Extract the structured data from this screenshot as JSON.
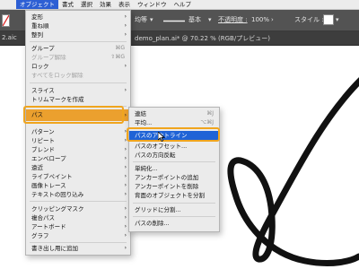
{
  "menubar": {
    "items": [
      "",
      "オブジェクト",
      "書式",
      "選択",
      "効果",
      "表示",
      "ウィンドウ",
      "ヘルプ"
    ]
  },
  "controlbar": {
    "uniform_label": "均等",
    "stroke_profile_label": "基本",
    "opacity_label": "不透明度 :",
    "opacity_value": "100%",
    "style_label": "スタイル :"
  },
  "tab": {
    "left_fragment": "2.aic",
    "document_title": "demo_plan.ai* @ 70.22 % (RGB/プレビュー)"
  },
  "object_menu": {
    "items": [
      {
        "label": "変形",
        "arrow": "›"
      },
      {
        "label": "重ね順",
        "arrow": "›"
      },
      {
        "label": "整列",
        "arrow": "›"
      },
      {
        "label": "グループ",
        "shortcut": "⌘G"
      },
      {
        "label": "グループ解除",
        "shortcut": "⇧⌘G",
        "disabled": true
      },
      {
        "label": "ロック",
        "arrow": "›"
      },
      {
        "label": "すべてをロック解除",
        "disabled": true
      },
      {
        "label": "スライス",
        "arrow": "›"
      },
      {
        "label": "トリムマークを作成"
      },
      {
        "label": "パス",
        "arrow": "›"
      },
      {
        "label": "パターン",
        "arrow": "›"
      },
      {
        "label": "リピート",
        "arrow": "›"
      },
      {
        "label": "ブレンド",
        "arrow": "›"
      },
      {
        "label": "エンベロープ",
        "arrow": "›"
      },
      {
        "label": "遠近",
        "arrow": "›"
      },
      {
        "label": "ライブペイント",
        "arrow": "›"
      },
      {
        "label": "画像トレース",
        "arrow": "›"
      },
      {
        "label": "テキストの回り込み",
        "arrow": "›"
      },
      {
        "label": "クリッピングマスク",
        "arrow": "›"
      },
      {
        "label": "複合パス",
        "arrow": "›"
      },
      {
        "label": "アートボード",
        "arrow": "›"
      },
      {
        "label": "グラフ",
        "arrow": "›"
      },
      {
        "label": "書き出し用に追加",
        "arrow": "›"
      }
    ]
  },
  "path_submenu": {
    "items": [
      {
        "label": "連結",
        "shortcut": "⌘J"
      },
      {
        "label": "平均...",
        "shortcut": "⌥⌘J"
      },
      {
        "label": "パスのアウトライン"
      },
      {
        "label": "パスのオフセット..."
      },
      {
        "label": "パスの方向反転"
      },
      {
        "label": "単純化..."
      },
      {
        "label": "アンカーポイントの追加"
      },
      {
        "label": "アンカーポイントを削除"
      },
      {
        "label": "背面のオブジェクトを分割"
      },
      {
        "label": "グリッドに分割..."
      },
      {
        "label": "パスの削除..."
      }
    ]
  },
  "colors": {
    "highlight_orange": "#eba02e",
    "selection_blue": "#1f63d6",
    "stroke_black": "#111111"
  }
}
